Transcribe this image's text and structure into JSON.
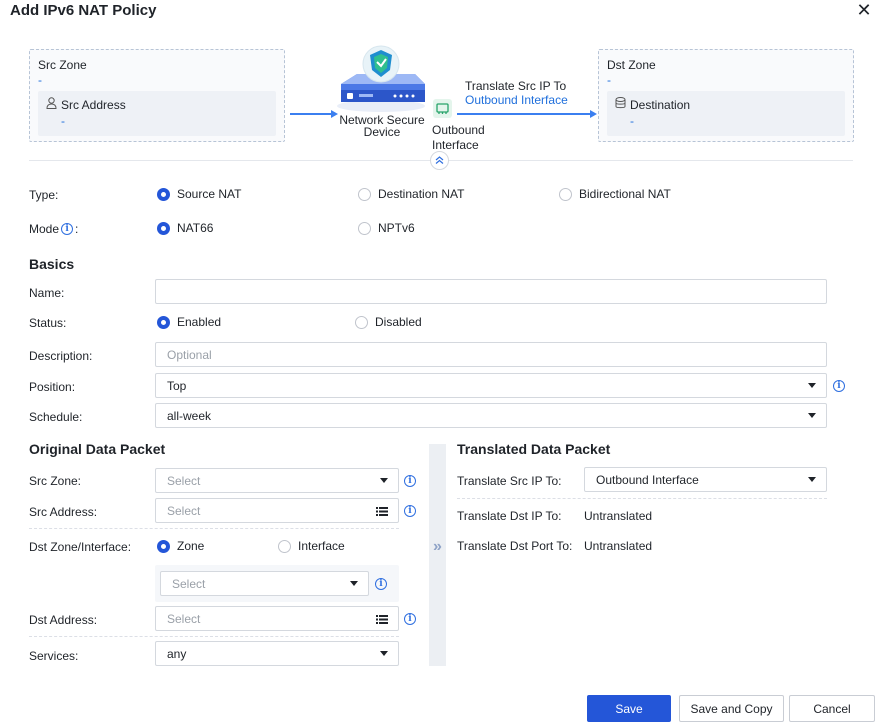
{
  "dialog": {
    "title": "Add IPv6 NAT Policy",
    "close": "✕"
  },
  "diagram": {
    "src_zone": {
      "title": "Src Zone",
      "value": "-",
      "address_label": "Src Address",
      "address_value": "-"
    },
    "device": {
      "label_line1": "Network Secure",
      "label_line2": "Device"
    },
    "outbound": {
      "line1": "Outbound",
      "line2": "Interface"
    },
    "translate": {
      "line1": "Translate Src IP To",
      "line2": "Outbound Interface"
    },
    "dst_zone": {
      "title": "Dst Zone",
      "value": "-",
      "dest_label": "Destination",
      "dest_value": "-"
    },
    "collapse_icon": "double-chevron-up-icon"
  },
  "type": {
    "label": "Type:",
    "options": [
      {
        "label": "Source NAT",
        "checked": true
      },
      {
        "label": "Destination NAT",
        "checked": false
      },
      {
        "label": "Bidirectional NAT",
        "checked": false
      }
    ]
  },
  "mode": {
    "label": "Mode",
    "colon": ":",
    "options": [
      {
        "label": "NAT66",
        "checked": true
      },
      {
        "label": "NPTv6",
        "checked": false
      }
    ]
  },
  "basics": {
    "heading": "Basics",
    "name": {
      "label": "Name:",
      "value": ""
    },
    "status": {
      "label": "Status:",
      "options": [
        {
          "label": "Enabled",
          "checked": true
        },
        {
          "label": "Disabled",
          "checked": false
        }
      ]
    },
    "description": {
      "label": "Description:",
      "placeholder": "Optional"
    },
    "position": {
      "label": "Position:",
      "value": "Top"
    },
    "schedule": {
      "label": "Schedule:",
      "value": "all-week"
    }
  },
  "original": {
    "heading": "Original Data Packet",
    "src_zone": {
      "label": "Src Zone:",
      "placeholder": "Select"
    },
    "src_address": {
      "label": "Src Address:",
      "placeholder": "Select"
    },
    "dst_zone_interface": {
      "label": "Dst Zone/Interface:",
      "options": [
        {
          "label": "Zone",
          "checked": true
        },
        {
          "label": "Interface",
          "checked": false
        }
      ],
      "select_placeholder": "Select"
    },
    "dst_address": {
      "label": "Dst Address:",
      "placeholder": "Select"
    },
    "services": {
      "label": "Services:",
      "value": "any"
    }
  },
  "translated": {
    "heading": "Translated Data Packet",
    "src_ip": {
      "label": "Translate Src IP To:",
      "value": "Outbound Interface"
    },
    "dst_ip": {
      "label": "Translate Dst IP To:",
      "value": "Untranslated"
    },
    "dst_port": {
      "label": "Translate Dst Port To:",
      "value": "Untranslated"
    }
  },
  "divider_icon": "»",
  "footer": {
    "save": "Save",
    "save_copy": "Save and Copy",
    "cancel": "Cancel"
  },
  "colors": {
    "primary": "#2456d8",
    "link": "#1f6fdc",
    "arrow": "#3b7ff0"
  }
}
